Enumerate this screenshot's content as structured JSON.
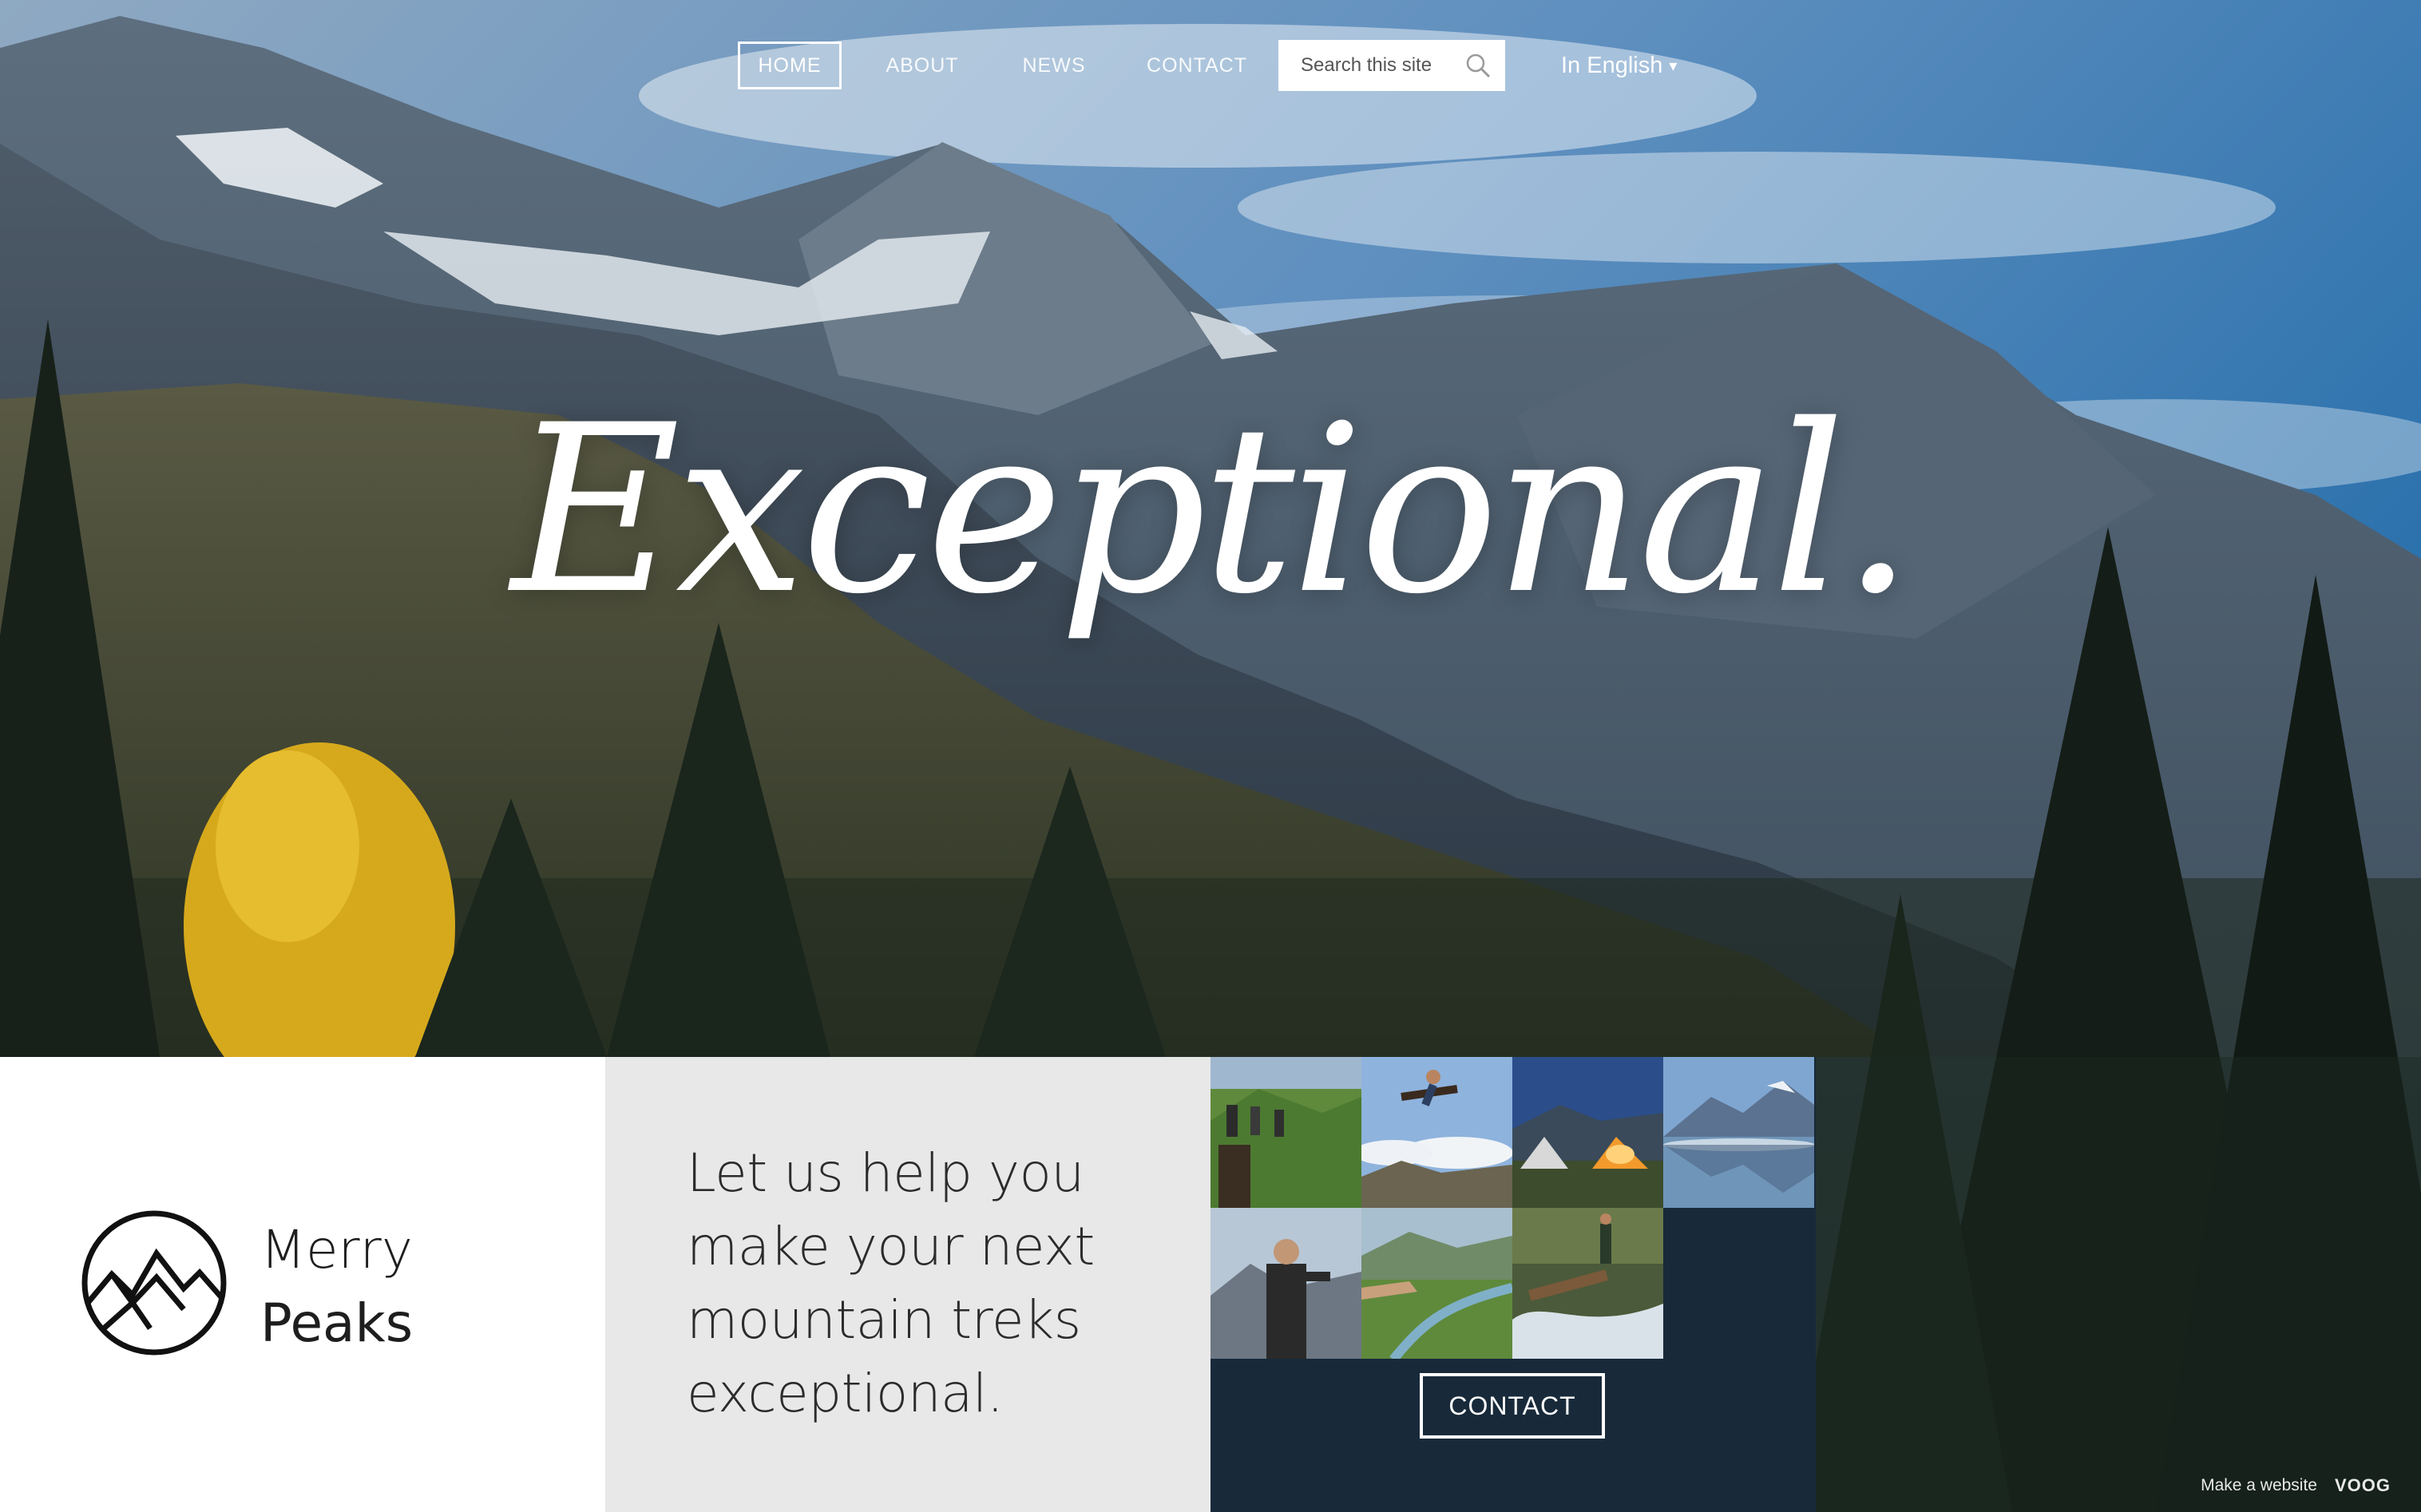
{
  "nav": {
    "items": [
      {
        "label": "HOME",
        "active": true
      },
      {
        "label": "ABOUT",
        "active": false
      },
      {
        "label": "NEWS",
        "active": false
      },
      {
        "label": "CONTACT",
        "active": false
      }
    ],
    "search_placeholder": "Search this site",
    "language": "In English",
    "language_caret": "▾"
  },
  "hero": {
    "title": "Exceptional."
  },
  "brand": {
    "line1": "Merry",
    "line2": "Peaks"
  },
  "tagline": "Let us help you make your next mountain treks exceptional.",
  "gallery": {
    "photos": [
      "hikers-on-trail",
      "person-jumping",
      "tents-at-dusk",
      "mountain-lake",
      "man-on-peak",
      "pointing-at-valley",
      "mountain-stream"
    ],
    "contact_label": "CONTACT"
  },
  "footer": {
    "credit_text": "Make a website",
    "credit_logo": "VOOG"
  },
  "colors": {
    "gallery_bg": "#182a3a",
    "tagline_bg": "#e8e8e8",
    "logo_bg": "#ffffff",
    "sky": "#2f6fa3"
  }
}
